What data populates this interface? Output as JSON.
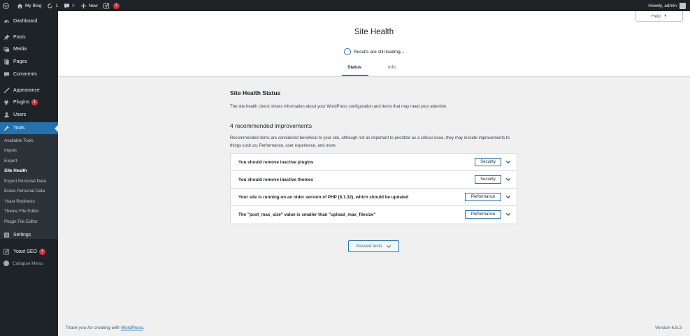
{
  "adminbar": {
    "site_name": "My Blog",
    "updates_count": "1",
    "comments_count": "0",
    "new_label": "New",
    "yoast_count": "1",
    "howdy": "Howdy, admin"
  },
  "sidebar": {
    "items": [
      {
        "label": "Dashboard",
        "icon": "dashboard-icon"
      },
      {
        "label": "Posts",
        "icon": "pin-icon"
      },
      {
        "label": "Media",
        "icon": "media-icon"
      },
      {
        "label": "Pages",
        "icon": "pages-icon"
      },
      {
        "label": "Comments",
        "icon": "comment-icon"
      },
      {
        "label": "Appearance",
        "icon": "brush-icon"
      },
      {
        "label": "Plugins",
        "icon": "plug-icon",
        "badge": "1"
      },
      {
        "label": "Users",
        "icon": "user-icon"
      },
      {
        "label": "Tools",
        "icon": "wrench-icon"
      },
      {
        "label": "Settings",
        "icon": "settings-icon"
      },
      {
        "label": "Yoast SEO",
        "icon": "yoast-icon",
        "badge": "1"
      }
    ],
    "submenu": [
      "Available Tools",
      "Import",
      "Export",
      "Site Health",
      "Export Personal Data",
      "Erase Personal Data",
      "Yoast Redirects",
      "Theme File Editor",
      "Plugin File Editor"
    ],
    "collapse_label": "Collapse Menu"
  },
  "header": {
    "help_label": "Help",
    "title": "Site Health",
    "loading_text": "Results are still loading...",
    "tabs": [
      "Status",
      "Info"
    ]
  },
  "main": {
    "status_heading": "Site Health Status",
    "status_desc": "The site health check shows information about your WordPress configuration and items that may need your attention.",
    "improvements_heading": "4 recommended improvements",
    "improvements_desc": "Recommended items are considered beneficial to your site, although not as important to prioritize as a critical issue, they may include improvements to things such as; Performance, user experience, and more.",
    "issues": [
      {
        "title": "You should remove inactive plugins",
        "badge": "Security"
      },
      {
        "title": "You should remove inactive themes",
        "badge": "Security"
      },
      {
        "title": "Your site is running on an older version of PHP (8.1.32), which should be updated",
        "badge": "Performance"
      },
      {
        "title": "The \"post_max_size\" value is smaller than \"upload_max_filesize\"",
        "badge": "Performance"
      }
    ],
    "passed_tests_label": "Passed tests"
  },
  "footer": {
    "thanks_prefix": "Thank you for creating with",
    "wordpress_link": "WordPress",
    "thanks_suffix": ".",
    "version": "Version 6.8.3"
  },
  "colors": {
    "accent": "#2271b1",
    "admin_dark": "#1d2327",
    "badge_red": "#d63638"
  }
}
